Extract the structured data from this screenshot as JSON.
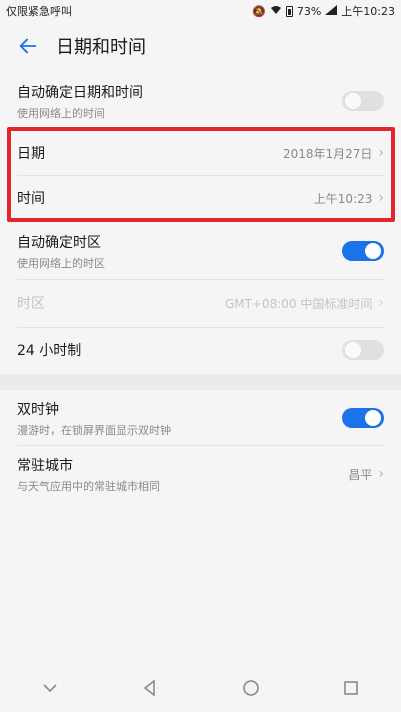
{
  "statusbar": {
    "left_text": "仅限紧急呼叫",
    "battery": "73%",
    "time": "上午10:23"
  },
  "appbar": {
    "title": "日期和时间"
  },
  "rows": {
    "auto_datetime": {
      "title": "自动确定日期和时间",
      "subtitle": "使用网络上的时间",
      "toggle": "off"
    },
    "date": {
      "title": "日期",
      "value": "2018年1月27日"
    },
    "time": {
      "title": "时间",
      "value": "上午10:23"
    },
    "auto_timezone": {
      "title": "自动确定时区",
      "subtitle": "使用网络上的时区",
      "toggle": "on"
    },
    "timezone": {
      "title": "时区",
      "value": "GMT+08:00 中国标准时间",
      "disabled": true
    },
    "hour24": {
      "title": "24 小时制",
      "toggle": "off"
    },
    "dual_clock": {
      "title": "双时钟",
      "subtitle": "漫游时，在锁屏界面显示双时钟",
      "toggle": "on"
    },
    "home_city": {
      "title": "常驻城市",
      "subtitle": "与天气应用中的常驻城市相同",
      "value": "昌平"
    }
  },
  "colors": {
    "accent": "#1a73e8",
    "highlight": "#e2262d"
  },
  "icons": {
    "back": "back-arrow-icon",
    "nav": [
      "collapse-icon",
      "back-icon",
      "home-icon",
      "recents-icon"
    ]
  }
}
